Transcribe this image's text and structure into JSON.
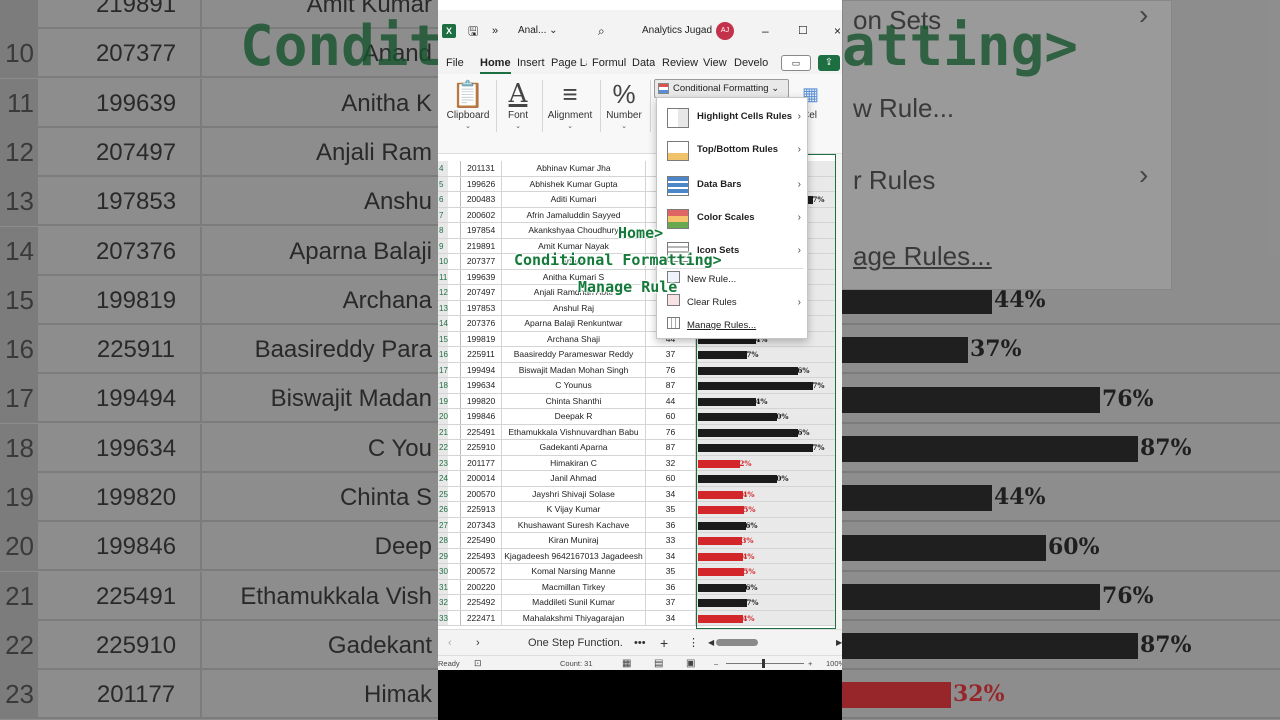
{
  "app": {
    "file_name": "Anal...",
    "workspace": "Analytics Jugad",
    "avatar_initials": "AJ",
    "accent_color": "#1d6f42"
  },
  "menu_tabs": [
    "File",
    "Home",
    "Insert",
    "Page La",
    "Formul",
    "Data",
    "Review",
    "View",
    "Develo"
  ],
  "ribbon": {
    "clipboard": "Clipboard",
    "font": "Font",
    "alignment": "Alignment",
    "number": "Number",
    "conditional_formatting": "Conditional Formatting",
    "cells_partial": "Cel"
  },
  "dropdown": {
    "highlight": "Highlight Cells Rules",
    "topbottom": "Top/Bottom Rules",
    "databars": "Data Bars",
    "colorscales": "Color Scales",
    "iconsets": "Icon Sets",
    "newrule": "New Rule...",
    "clearrules": "Clear Rules",
    "managerules": "Manage Rules..."
  },
  "overlay": {
    "line1": "Home>",
    "line2": "Conditional Formatting>",
    "line3": "Manage Rule"
  },
  "rows": [
    {
      "rn": "4",
      "id": "201131",
      "name": "Abhinav Kumar Jha",
      "score": "",
      "pct": null
    },
    {
      "rn": "5",
      "id": "199626",
      "name": "Abhishek Kumar Gupta",
      "score": "",
      "pct": null
    },
    {
      "rn": "6",
      "id": "200483",
      "name": "Aditi Kumari",
      "score": "",
      "pct": 87
    },
    {
      "rn": "7",
      "id": "200602",
      "name": "Afrin Jamaluddin Sayyed",
      "score": "",
      "pct": null
    },
    {
      "rn": "8",
      "id": "197854",
      "name": "Akankshyaa Choudhury",
      "score": "",
      "pct": null
    },
    {
      "rn": "9",
      "id": "219891",
      "name": "Amit Kumar Nayak",
      "score": "",
      "pct": null
    },
    {
      "rn": "10",
      "id": "207377",
      "name": "Anand",
      "score": "",
      "pct": null
    },
    {
      "rn": "11",
      "id": "199639",
      "name": "Anitha Kumari S",
      "score": "",
      "pct": null
    },
    {
      "rn": "12",
      "id": "207497",
      "name": "Anjali Ramdhan Aote",
      "score": "",
      "pct": null
    },
    {
      "rn": "13",
      "id": "197853",
      "name": "Anshul Raj",
      "score": "",
      "pct": null
    },
    {
      "rn": "14",
      "id": "207376",
      "name": "Aparna Balaji Renkuntwar",
      "score": "",
      "pct": null
    },
    {
      "rn": "15",
      "id": "199819",
      "name": "Archana Shaji",
      "score": "44",
      "pct": 44
    },
    {
      "rn": "16",
      "id": "225911",
      "name": "Baasireddy Parameswar Reddy",
      "score": "37",
      "pct": 37
    },
    {
      "rn": "17",
      "id": "199494",
      "name": "Biswajit Madan Mohan Singh",
      "score": "76",
      "pct": 76
    },
    {
      "rn": "18",
      "id": "199634",
      "name": "C Younus",
      "score": "87",
      "pct": 87
    },
    {
      "rn": "19",
      "id": "199820",
      "name": "Chinta Shanthi",
      "score": "44",
      "pct": 44
    },
    {
      "rn": "20",
      "id": "199846",
      "name": "Deepak R",
      "score": "60",
      "pct": 60
    },
    {
      "rn": "21",
      "id": "225491",
      "name": "Ethamukkala Vishnuvardhan Babu",
      "score": "76",
      "pct": 76
    },
    {
      "rn": "22",
      "id": "225910",
      "name": "Gadekanti Aparna",
      "score": "87",
      "pct": 87
    },
    {
      "rn": "23",
      "id": "201177",
      "name": "Himakiran C",
      "score": "32",
      "pct": 32
    },
    {
      "rn": "24",
      "id": "200014",
      "name": "Janil Ahmad",
      "score": "60",
      "pct": 60
    },
    {
      "rn": "25",
      "id": "200570",
      "name": "Jayshri Shivaji Solase",
      "score": "34",
      "pct": 34
    },
    {
      "rn": "26",
      "id": "225913",
      "name": "K Vijay Kumar",
      "score": "35",
      "pct": 35
    },
    {
      "rn": "27",
      "id": "207343",
      "name": "Khushawant Suresh Kachave",
      "score": "36",
      "pct": 36
    },
    {
      "rn": "28",
      "id": "225490",
      "name": "Kiran Muniraj",
      "score": "33",
      "pct": 33
    },
    {
      "rn": "29",
      "id": "225493",
      "name": "Kjagadeesh 9642167013 Jagadeesh",
      "score": "34",
      "pct": 34
    },
    {
      "rn": "30",
      "id": "200572",
      "name": "Komal Narsing Manne",
      "score": "35",
      "pct": 35
    },
    {
      "rn": "31",
      "id": "200220",
      "name": "Macmillan Tirkey",
      "score": "36",
      "pct": 36
    },
    {
      "rn": "32",
      "id": "225492",
      "name": "Maddileti Sunil Kumar",
      "score": "37",
      "pct": 37
    },
    {
      "rn": "33",
      "id": "222471",
      "name": "Mahalakshmi Thiyagarajan",
      "score": "34",
      "pct": 34
    }
  ],
  "sheet_tab": "One Step Function.",
  "status": {
    "ready": "Ready",
    "count": "Count: 31",
    "zoom": "100%"
  },
  "red_threshold": 35,
  "bar_colors": {
    "high": "#1b1b1b",
    "low": "#d3262b"
  },
  "bg_left_rows": [
    {
      "rn": "",
      "id": "219891",
      "name": "Amit Kumar"
    },
    {
      "rn": "10",
      "id": "207377",
      "name": "Anand"
    },
    {
      "rn": "11",
      "id": "199639",
      "name": "Anitha K"
    },
    {
      "rn": "12",
      "id": "207497",
      "name": "Anjali Ram"
    },
    {
      "rn": "13",
      "id": "197853",
      "name": "Anshu"
    },
    {
      "rn": "14",
      "id": "207376",
      "name": "Aparna Balaji"
    },
    {
      "rn": "15",
      "id": "199819",
      "name": "Archana"
    },
    {
      "rn": "16",
      "id": "225911",
      "name": "Baasireddy Para"
    },
    {
      "rn": "17",
      "id": "199494",
      "name": "Biswajit Madan"
    },
    {
      "rn": "18",
      "id": "199634",
      "name": "C You"
    },
    {
      "rn": "19",
      "id": "199820",
      "name": "Chinta S"
    },
    {
      "rn": "20",
      "id": "199846",
      "name": "Deep"
    },
    {
      "rn": "21",
      "id": "225491",
      "name": "Ethamukkala Vish"
    },
    {
      "rn": "22",
      "id": "225910",
      "name": "Gadekant"
    },
    {
      "rn": "23",
      "id": "201177",
      "name": "Himak"
    }
  ],
  "bg_left_title": "Conditi",
  "bg_right_title": "atting>",
  "bg_right_menu": {
    "icon_sets": "on Sets",
    "new_rule": "w Rule...",
    "clear_rules": "r Rules",
    "manage_rules": "age Rules..."
  },
  "bg_right_pcts": [
    {
      "pct": 44,
      "label": "44%"
    },
    {
      "pct": 37,
      "label": "37%"
    },
    {
      "pct": 76,
      "label": "76%"
    },
    {
      "pct": 87,
      "label": "87%"
    },
    {
      "pct": 44,
      "label": "44%"
    },
    {
      "pct": 60,
      "label": "60%"
    },
    {
      "pct": 76,
      "label": "76%"
    },
    {
      "pct": 87,
      "label": "87%"
    },
    {
      "pct": 32,
      "label": "32%"
    }
  ]
}
